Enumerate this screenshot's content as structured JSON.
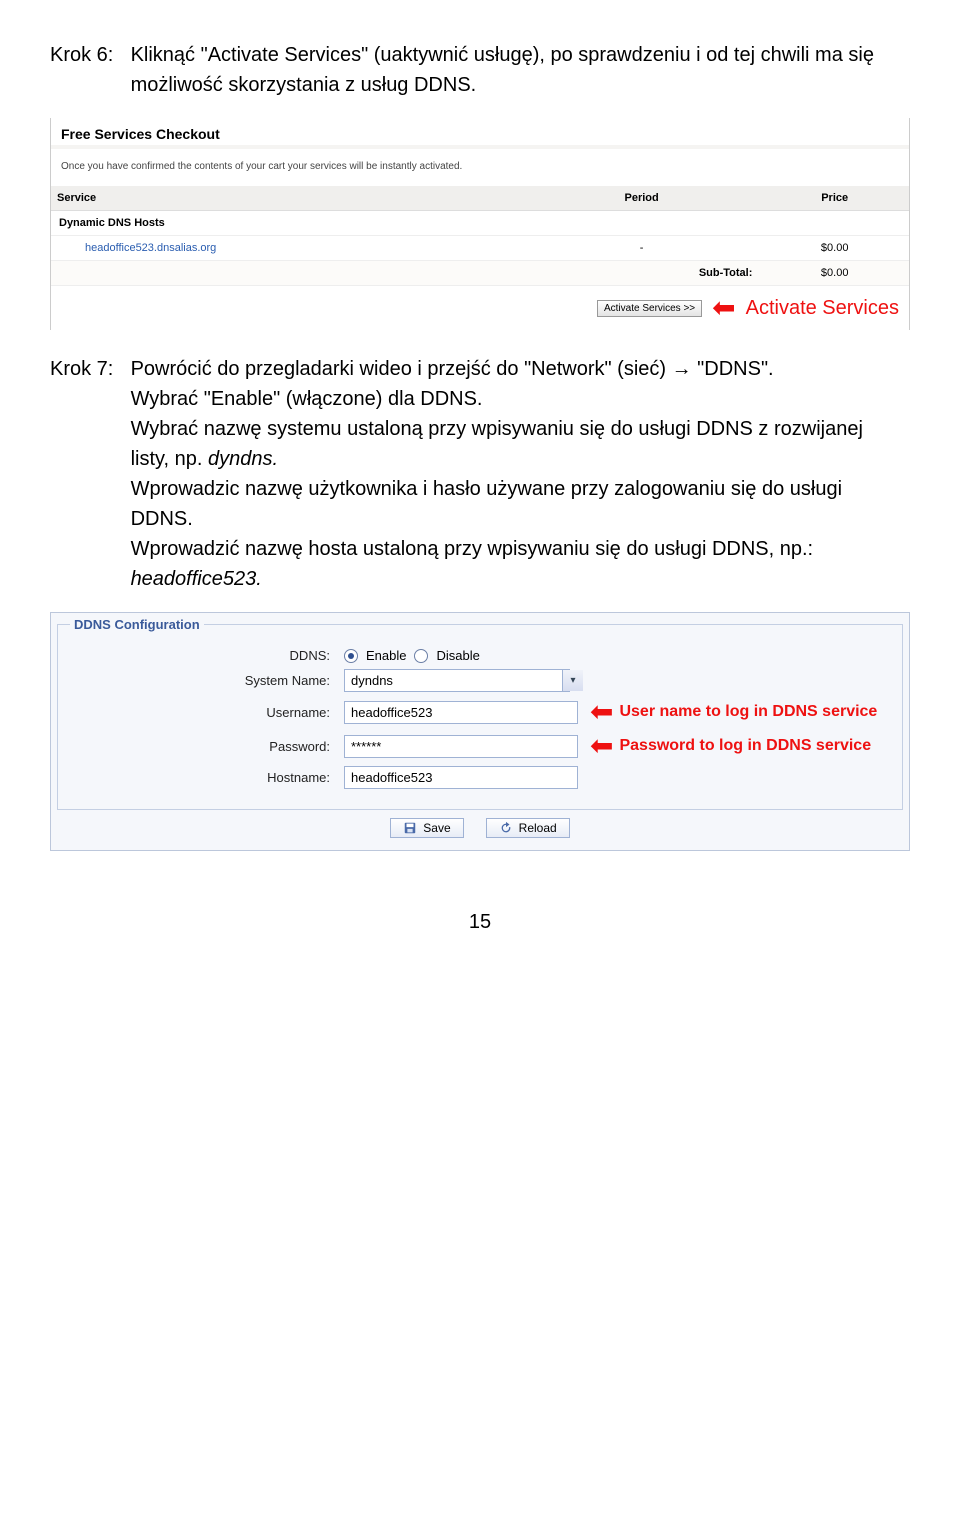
{
  "step6": {
    "label": "Krok 6:",
    "body": "Kliknąć \"Activate Services\" (uaktywnić usługę), po sprawdzeniu i od tej chwili ma się możliwość skorzystania z usług DDNS."
  },
  "checkout": {
    "title": "Free Services Checkout",
    "note": "Once you have confirmed the contents of your cart your services will be instantly activated.",
    "columns": {
      "service": "Service",
      "period": "Period",
      "price": "Price"
    },
    "category": "Dynamic DNS Hosts",
    "host_link": "headoffice523.dnsalias.org",
    "period_val": "-",
    "price_val": "$0.00",
    "subtotal_label": "Sub-Total:",
    "subtotal_val": "$0.00",
    "activate_btn": "Activate Services >>",
    "activate_callout": "Activate Services"
  },
  "step7": {
    "label": "Krok 7:",
    "line1": "Powrócić do przegladarki wideo i przejść do \"Network\" (sieć) → \"DDNS\".",
    "line2": "Wybrać \"Enable\" (włączone) dla DDNS.",
    "line3_a": "Wybrać nazwę systemu ustaloną przy wpisywaniu się do usługi DDNS z rozwijanej listy, np. ",
    "line3_b": "dyndns.",
    "line4": "Wprowadzic nazwę użytkownika i hasło używane przy zalogowaniu się do usługi DDNS.",
    "line5_a": "Wprowadzić nazwę hosta ustaloną przy wpisywaniu się do usługi DDNS, np.: ",
    "line5_b": "headoffice523."
  },
  "ddns_form": {
    "legend": "DDNS Configuration",
    "labels": {
      "ddns": "DDNS:",
      "system_name": "System Name:",
      "username": "Username:",
      "password": "Password:",
      "hostname": "Hostname:"
    },
    "radio": {
      "enable": "Enable",
      "disable": "Disable",
      "selected": "enable"
    },
    "values": {
      "system_name": "dyndns",
      "username": "headoffice523",
      "password": "******",
      "hostname": "headoffice523"
    },
    "callouts": {
      "username": "User name to log in DDNS service",
      "password": "Password to log in DDNS service"
    },
    "buttons": {
      "save": "Save",
      "reload": "Reload"
    }
  },
  "page_number": "15"
}
